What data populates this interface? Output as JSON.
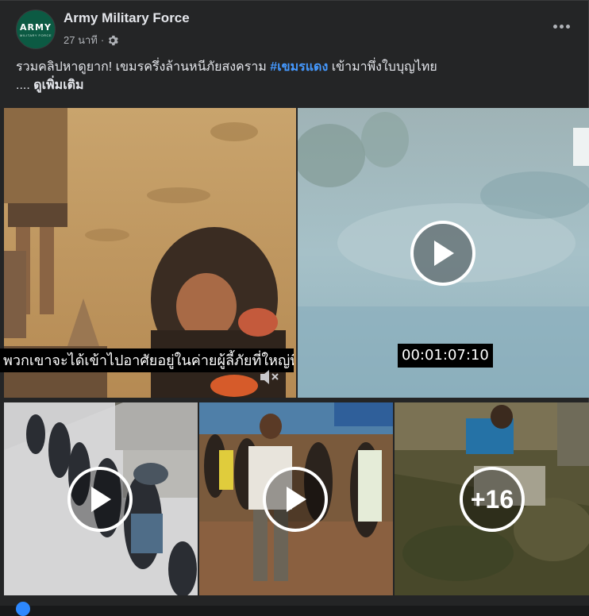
{
  "post": {
    "page_name": "Army Military Force",
    "timestamp": "27 นาที",
    "separator": "·",
    "avatar": {
      "text": "ARMY",
      "subtext": "MILITARY FORCE"
    },
    "caption": {
      "text_before": "รวมคลิปหาดูยาก! เขมรครึ่งล้านหนีภัยสงคราม ",
      "hashtag": "#เขมรแดง",
      "text_after": " เข้ามาพึ่งใบบุญไทย",
      "ellipsis": "....",
      "see_more": "ดูเพิ่มเติม"
    }
  },
  "media": {
    "video1_subtitle": "พวกเขาจะได้เข้าไปอาศัยอยู่ในค่ายผู้ลี้ภัยที่ใหญ่ที่สุด",
    "video2_timecode": "00:01:07:10",
    "more_count": "+16"
  },
  "icons": {
    "gear": "gear-icon",
    "more": "more-options-icon",
    "play": "play-icon",
    "mute": "mute-icon"
  },
  "colors": {
    "background": "#242526",
    "text": "#e4e6eb",
    "secondary_text": "#b0b3b8",
    "hashtag": "#4599ff"
  }
}
